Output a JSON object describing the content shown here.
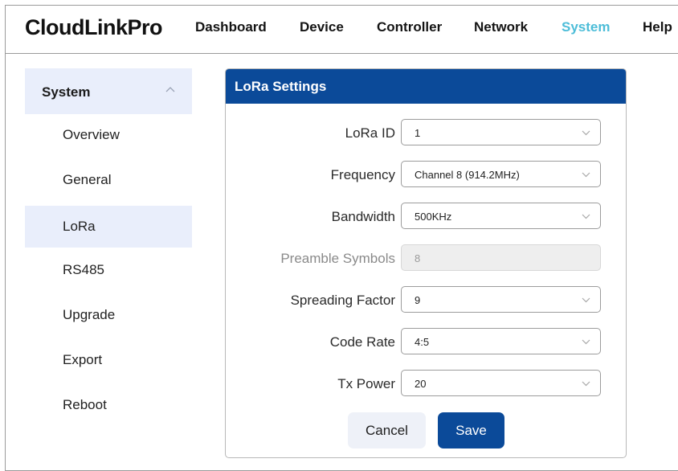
{
  "header": {
    "brand": "CloudLinkPro",
    "nav": [
      "Dashboard",
      "Device",
      "Controller",
      "Network",
      "System",
      "Help"
    ],
    "active_nav": "System",
    "active_color": "#4dbdd8"
  },
  "sidebar": {
    "section_title": "System",
    "section_icon": "chevron-up-icon",
    "items": [
      "Overview",
      "General",
      "LoRa",
      "RS485",
      "Upgrade",
      "Export",
      "Reboot"
    ],
    "active_item": "LoRa"
  },
  "panel": {
    "title": "LoRa Settings",
    "header_color": "#0b4a99",
    "fields": [
      {
        "label": "LoRa ID",
        "value": "1"
      },
      {
        "label": "Frequency",
        "value": "Channel 8 (914.2MHz)"
      },
      {
        "label": "Bandwidth",
        "value": "500KHz"
      },
      {
        "label": "Preamble Symbols",
        "value": "8",
        "disabled": true
      },
      {
        "label": "Spreading Factor",
        "value": "9"
      },
      {
        "label": "Code Rate",
        "value": "4:5"
      },
      {
        "label": "Tx Power",
        "value": "20"
      }
    ],
    "cancel_label": "Cancel",
    "save_label": "Save"
  }
}
